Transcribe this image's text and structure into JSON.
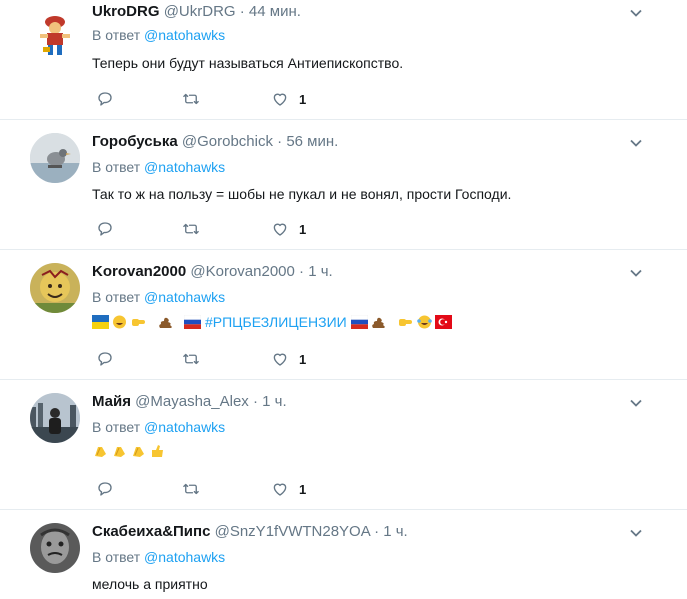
{
  "tweets": [
    {
      "name": "UkroDRG",
      "handle": "@UkrDRG",
      "time": "44 мин.",
      "reply_prefix": "В ответ",
      "mention": "@natohawks",
      "text": "Теперь они будут называться Антиепископство.",
      "likes": "1"
    },
    {
      "name": "Горобуська",
      "handle": "@Gorobchick",
      "time": "56 мин.",
      "reply_prefix": "В ответ",
      "mention": "@natohawks",
      "text": "Так то ж на пользу = шобы не пукал и не вонял, прости Господи.",
      "likes": "1"
    },
    {
      "name": "Korovan2000",
      "handle": "@Korovan2000",
      "time": "1 ч.",
      "reply_prefix": "В ответ",
      "mention": "@natohawks",
      "hashtag": "#РПЦБЕЗЛИЦЕНЗИИ",
      "likes": "1"
    },
    {
      "name": "Майя",
      "handle": "@Mayasha_Alex",
      "time": "1 ч.",
      "reply_prefix": "В ответ",
      "mention": "@natohawks",
      "likes": "1"
    },
    {
      "name": "Скабеиха&Пипс",
      "handle": "@SnzY1fVWTN28YOA",
      "time": "1 ч.",
      "reply_prefix": "В ответ",
      "mention": "@natohawks",
      "text": "мелочь а приятно"
    }
  ],
  "icons": {
    "reply": "reply-icon",
    "retweet": "retweet-icon",
    "like": "heart-icon",
    "more": "chevron-down-icon"
  },
  "colors": {
    "link": "#1da1f2",
    "muted": "#657786",
    "divider": "#e6ecf0"
  }
}
